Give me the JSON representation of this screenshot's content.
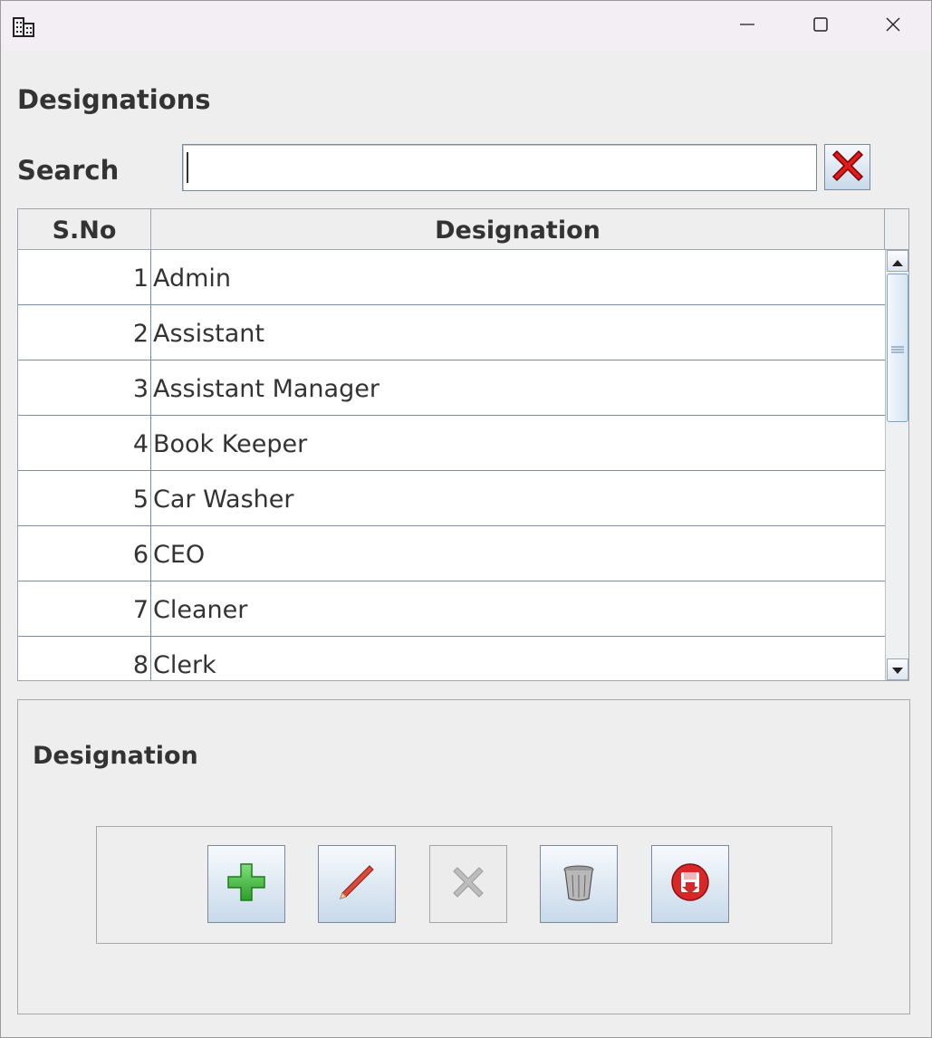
{
  "window": {
    "icon": "building-icon",
    "controls": [
      "minimize-icon",
      "maximize-icon",
      "close-icon"
    ]
  },
  "page": {
    "title": "Designations"
  },
  "search": {
    "label": "Search",
    "value": "",
    "clear_icon": "red-x-icon"
  },
  "table": {
    "columns": [
      "S.No",
      "Designation"
    ],
    "rows": [
      {
        "sno": "1",
        "designation": "Admin"
      },
      {
        "sno": "2",
        "designation": "Assistant"
      },
      {
        "sno": "3",
        "designation": "Assistant Manager"
      },
      {
        "sno": "4",
        "designation": "Book Keeper"
      },
      {
        "sno": "5",
        "designation": "Car Washer"
      },
      {
        "sno": "6",
        "designation": "CEO"
      },
      {
        "sno": "7",
        "designation": "Cleaner"
      },
      {
        "sno": "8",
        "designation": "Clerk"
      }
    ]
  },
  "form": {
    "section_label": "Designation",
    "buttons": [
      {
        "icon": "plus-icon",
        "enabled": true
      },
      {
        "icon": "pencil-icon",
        "enabled": true
      },
      {
        "icon": "cancel-x-icon",
        "enabled": false
      },
      {
        "icon": "trash-icon",
        "enabled": true
      },
      {
        "icon": "save-disk-icon",
        "enabled": true
      }
    ]
  },
  "colors": {
    "background": "#eeeeee",
    "titlebar": "#f3eef3",
    "grid_line": "#7a8fa5",
    "text": "#333333"
  }
}
